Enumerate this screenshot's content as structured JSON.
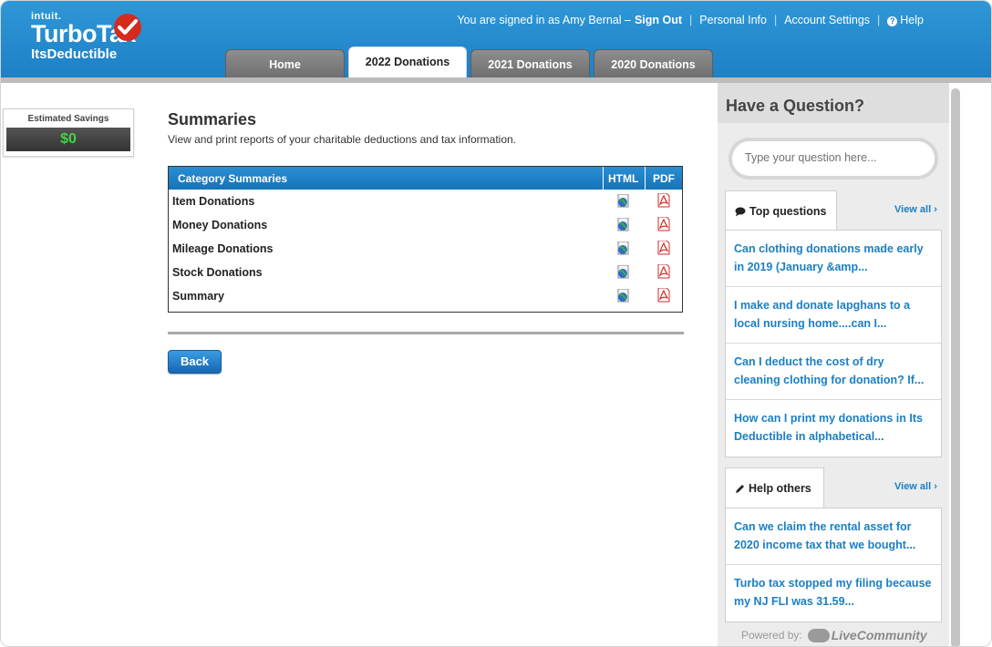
{
  "header": {
    "brand_intuit": "intuit.",
    "brand_name": "TurboTax",
    "brand_product": "ItsDeductible",
    "signed_in_text": "You are signed in as Amy Bernal –",
    "sign_out": "Sign Out",
    "personal_info": "Personal Info",
    "account_settings": "Account Settings",
    "help": "Help",
    "tabs": [
      {
        "label": "Home",
        "active": false
      },
      {
        "label": "2022 Donations",
        "active": true
      },
      {
        "label": "2021 Donations",
        "active": false
      },
      {
        "label": "2020 Donations",
        "active": false
      }
    ]
  },
  "savings": {
    "label": "Estimated Savings",
    "value": "$0"
  },
  "main": {
    "title": "Summaries",
    "subtitle": "View and print reports of your charitable deductions and tax information.",
    "table": {
      "header": "Category Summaries",
      "col_html": "HTML",
      "col_pdf": "PDF",
      "rows": [
        "Item Donations",
        "Money Donations",
        "Mileage Donations",
        "Stock Donations",
        "Summary"
      ]
    },
    "back_label": "Back"
  },
  "sidebar": {
    "title": "Have a Question?",
    "search_placeholder": "Type your question here...",
    "top_questions_label": "Top questions",
    "view_all_label": "View all",
    "top_questions": [
      "Can clothing donations made early in 2019 (January &amp...",
      "I make and donate lapghans to a local nursing home....can I...",
      "Can I deduct the cost of dry cleaning clothing for donation? If...",
      "How can I print my donations in Its Deductible in alphabetical..."
    ],
    "help_others_label": "Help others",
    "help_others": [
      "Can we claim the rental asset for 2020 income tax that we bought...",
      "Turbo tax stopped my filing because my NJ FLI was 31.59..."
    ],
    "powered_by": "Powered by:",
    "powered_brand": "LiveCommunity"
  },
  "colors": {
    "header_blue": "#1b7fc4",
    "link_blue": "#1a7fc4",
    "savings_green": "#3fd73f",
    "brand_red": "#d52b1e"
  }
}
